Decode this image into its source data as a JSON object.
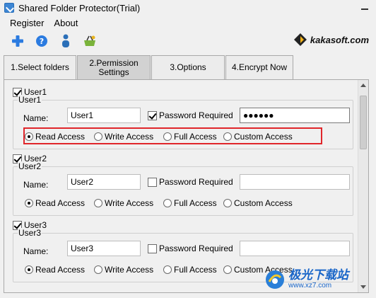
{
  "window": {
    "title": "Shared Folder Protector(Trial)"
  },
  "menu": {
    "items": [
      {
        "label": "Register"
      },
      {
        "label": "About"
      }
    ]
  },
  "toolbar": {
    "buttons": [
      "add-icon",
      "help-icon",
      "user-icon",
      "basket-icon"
    ]
  },
  "brand": {
    "text": "kakasoft.com"
  },
  "tabs": [
    {
      "label": "1.Select folders",
      "active": false
    },
    {
      "label": "2.Permission Settings",
      "active": true
    },
    {
      "label": "3.Options",
      "active": false
    },
    {
      "label": "4.Encrypt Now",
      "active": false
    }
  ],
  "users": [
    {
      "check_label": "User1",
      "checked": true,
      "group_title": "User1",
      "name_label": "Name:",
      "name_value": "User1",
      "password_required_label": "Password Required",
      "password_required": true,
      "password_value": "●●●●●●",
      "access_options": [
        "Read Access",
        "Write Access",
        "Full Access",
        "Custom Access"
      ],
      "selected_access": "Read Access",
      "highlighted": true
    },
    {
      "check_label": "User2",
      "checked": true,
      "group_title": "User2",
      "name_label": "Name:",
      "name_value": "User2",
      "password_required_label": "Password Required",
      "password_required": false,
      "password_value": "",
      "access_options": [
        "Read Access",
        "Write Access",
        "Full Access",
        "Custom Access"
      ],
      "selected_access": "Read Access",
      "highlighted": false
    },
    {
      "check_label": "User3",
      "checked": true,
      "group_title": "User3",
      "name_label": "Name:",
      "name_value": "User3",
      "password_required_label": "Password Required",
      "password_required": false,
      "password_value": "",
      "access_options": [
        "Read Access",
        "Write Access",
        "Full Access",
        "Custom Access"
      ],
      "selected_access": "Read Access",
      "highlighted": false
    }
  ],
  "watermark": {
    "main": "极光下载站",
    "sub": "www.xz7.com"
  },
  "colors": {
    "highlight": "#e0262b",
    "accent": "#1a66c8"
  }
}
